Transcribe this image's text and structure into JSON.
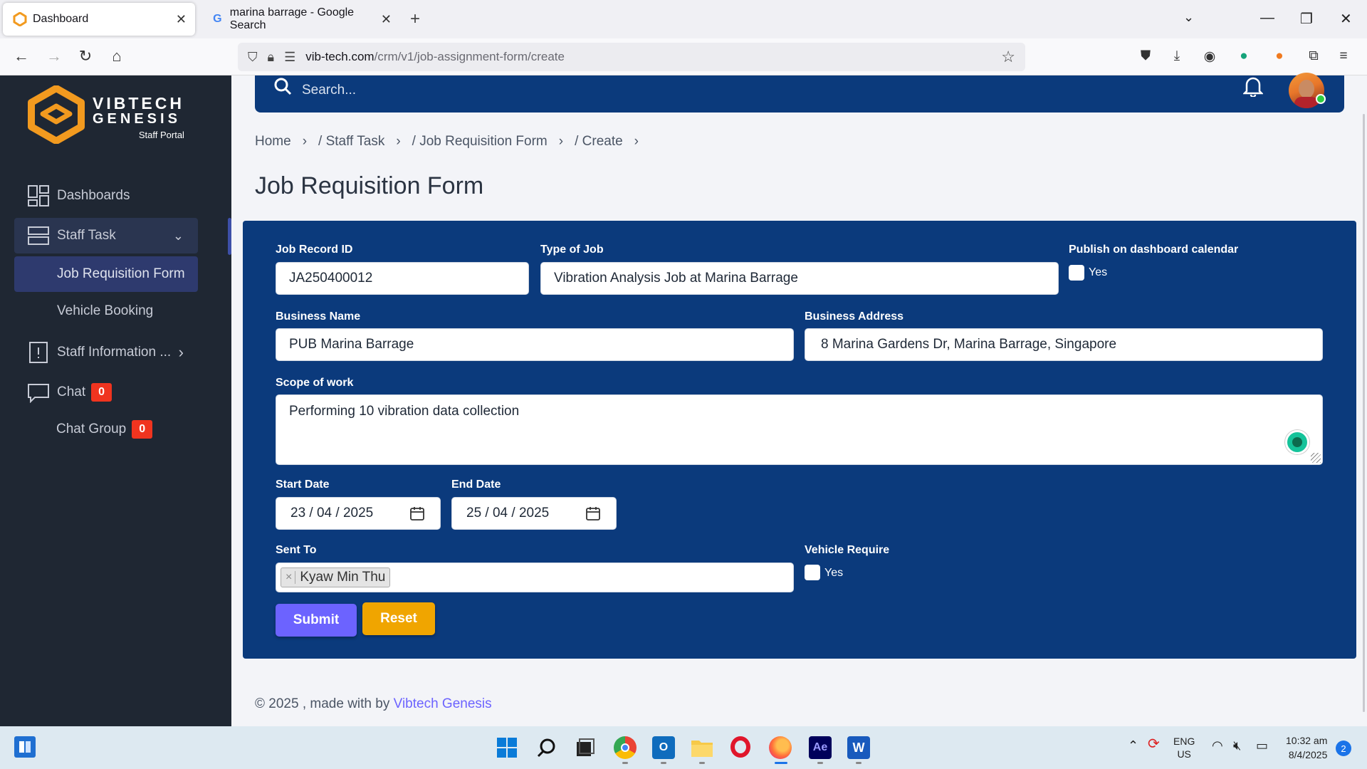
{
  "browser": {
    "tabs": [
      {
        "title": "Dashboard",
        "active": true
      },
      {
        "title": "marina barrage - Google Search",
        "active": false
      }
    ],
    "url_host": "vib-tech.com",
    "url_path": "/crm/v1/job-assignment-form/create"
  },
  "sidebar": {
    "logo_line1": "VIBTECH",
    "logo_line2": "GENESIS",
    "logo_sub": "Staff Portal",
    "items": [
      {
        "label": "Dashboards"
      },
      {
        "label": "Staff Task"
      },
      {
        "label": "Job Requisition Form"
      },
      {
        "label": "Vehicle Booking"
      },
      {
        "label": "Staff Information ..."
      },
      {
        "label": "Chat",
        "badge": "0"
      },
      {
        "label": "Chat Group",
        "badge": "0"
      }
    ]
  },
  "topbar": {
    "search_placeholder": "Search..."
  },
  "breadcrumb": [
    "Home",
    "Staff Task",
    "Job Requisition Form",
    "Create"
  ],
  "page_title": "Job Requisition Form",
  "form": {
    "job_record_id_label": "Job Record ID",
    "job_record_id": "JA250400012",
    "type_of_job_label": "Type of Job",
    "type_of_job": "Vibration Analysis Job at Marina Barrage",
    "publish_label": "Publish on dashboard calendar",
    "publish_yes": "Yes",
    "business_name_label": "Business Name",
    "business_name": "PUB Marina Barrage",
    "business_address_label": "Business Address",
    "business_address": "8 Marina Gardens Dr, Marina Barrage, Singapore",
    "scope_label": "Scope of work",
    "scope": "Performing 10 vibration data collection",
    "start_date_label": "Start Date",
    "start_date": "23 / 04 / 2025",
    "end_date_label": "End Date",
    "end_date": "25 / 04 / 2025",
    "sent_to_label": "Sent To",
    "sent_to_chip": "Kyaw Min Thu",
    "vehicle_label": "Vehicle Require",
    "vehicle_yes": "Yes",
    "submit": "Submit",
    "reset": "Reset"
  },
  "footer": {
    "text": "© 2025 , made with by ",
    "link": "Vibtech Genesis"
  },
  "taskbar": {
    "lang1": "ENG",
    "lang2": "US",
    "time": "10:32 am",
    "date": "8/4/2025",
    "notifications": "2"
  },
  "colors": {
    "sidebar_bg": "#1f2733",
    "primary_blue": "#0b3a7c",
    "submit": "#6c63ff",
    "reset": "#f0a500",
    "badge": "#f0341f",
    "logo_orange": "#f29a1f"
  }
}
